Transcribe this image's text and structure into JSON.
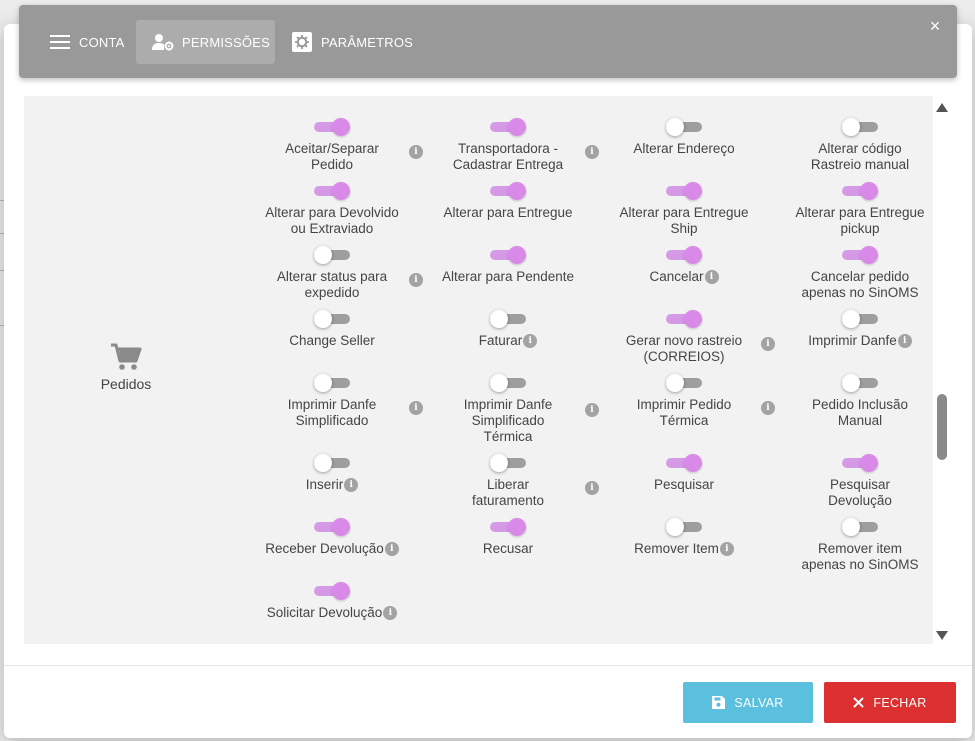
{
  "tabs": [
    {
      "label": "CONTA",
      "icon": "menu-icon",
      "active": false
    },
    {
      "label": "PERMISSÕES",
      "icon": "user-gear-icon",
      "active": true
    },
    {
      "label": "PARÂMETROS",
      "icon": "settings-icon",
      "active": false
    }
  ],
  "close_icon": "×",
  "section": {
    "label": "Pedidos",
    "icon": "cart-icon"
  },
  "permissions": [
    {
      "label": "Aceitar/Separar Pedido",
      "on": true,
      "info": true
    },
    {
      "label": "Transportadora - Cadastrar Entrega",
      "on": true,
      "info": true
    },
    {
      "label": "Alterar Endereço",
      "on": false,
      "info": false
    },
    {
      "label": "Alterar código Rastreio manual",
      "on": false,
      "info": true
    },
    {
      "label": "Alterar para Devolvido ou Extraviado",
      "on": true,
      "info": false
    },
    {
      "label": "Alterar para Entregue",
      "on": true,
      "info": false
    },
    {
      "label": "Alterar para Entregue Ship",
      "on": true,
      "info": false
    },
    {
      "label": "Alterar para Entregue pickup",
      "on": true,
      "info": false
    },
    {
      "label": "Alterar status para expedido",
      "on": false,
      "info": true
    },
    {
      "label": "Alterar para Pendente",
      "on": true,
      "info": false
    },
    {
      "label": "Cancelar",
      "on": true,
      "info": true
    },
    {
      "label": "Cancelar pedido apenas no SinOMS",
      "on": true,
      "info": true
    },
    {
      "label": "Change Seller",
      "on": false,
      "info": false
    },
    {
      "label": "Faturar",
      "on": false,
      "info": true
    },
    {
      "label": "Gerar novo rastreio (CORREIOS)",
      "on": true,
      "info": true
    },
    {
      "label": "Imprimir Danfe",
      "on": false,
      "info": true
    },
    {
      "label": "Imprimir Danfe Simplificado",
      "on": false,
      "info": true
    },
    {
      "label": "Imprimir Danfe Simplificado Térmica",
      "on": false,
      "info": true
    },
    {
      "label": "Imprimir Pedido Térmica",
      "on": false,
      "info": true
    },
    {
      "label": "Pedido Inclusão Manual",
      "on": false,
      "info": true
    },
    {
      "label": "Inserir",
      "on": false,
      "info": true
    },
    {
      "label": "Liberar faturamento",
      "on": false,
      "info": true
    },
    {
      "label": "Pesquisar",
      "on": true,
      "info": false
    },
    {
      "label": "Pesquisar Devolução",
      "on": true,
      "info": true
    },
    {
      "label": "Receber Devolução",
      "on": true,
      "info": true
    },
    {
      "label": "Recusar",
      "on": true,
      "info": false
    },
    {
      "label": "Remover Item",
      "on": false,
      "info": true
    },
    {
      "label": "Remover item apenas no SinOMS",
      "on": false,
      "info": true
    },
    {
      "label": "Solicitar Devolução",
      "on": true,
      "info": true
    }
  ],
  "info_glyph": "i",
  "buttons": {
    "save": {
      "label": "SALVAR",
      "icon": "floppy-icon"
    },
    "close": {
      "label": "FECHAR",
      "icon": "close-icon"
    }
  },
  "colors": {
    "tab_bar": "#999999",
    "toggle_on": "#d98ae9",
    "save": "#5bc0de",
    "close": "#dc2f2f"
  }
}
